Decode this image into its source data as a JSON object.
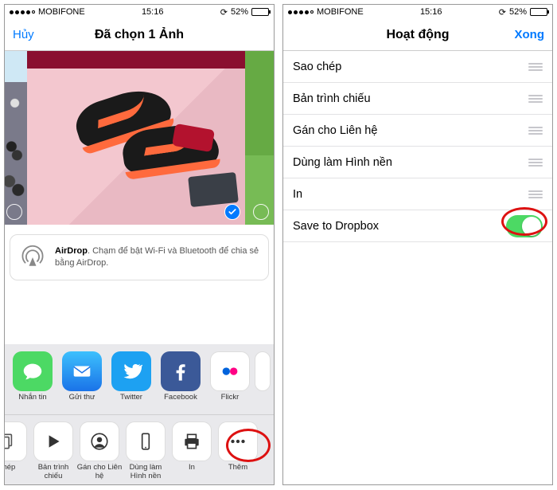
{
  "status": {
    "carrier": "MOBIFONE",
    "time": "15:16",
    "battery_pct": "52%"
  },
  "left": {
    "cancel": "Hủy",
    "title": "Đã chọn 1 Ảnh",
    "airdrop": {
      "title": "AirDrop",
      "text": ". Chạm để bật Wi-Fi và Bluetooth để chia sẻ bằng AirDrop."
    },
    "share": [
      {
        "name": "message",
        "label": "Nhắn tin",
        "color": "#4cd964"
      },
      {
        "name": "mail",
        "label": "Gửi thư",
        "color": "#1d9bf0"
      },
      {
        "name": "twitter",
        "label": "Twitter",
        "color": "#1da1f2"
      },
      {
        "name": "facebook",
        "label": "Facebook",
        "color": "#3b5998"
      },
      {
        "name": "flickr",
        "label": "Flickr",
        "color": "#ffffff"
      }
    ],
    "actions": [
      {
        "name": "copy",
        "label": "chép"
      },
      {
        "name": "slideshow",
        "label": "Bản trình chiếu"
      },
      {
        "name": "assign-contact",
        "label": "Gán cho Liên hệ"
      },
      {
        "name": "wallpaper",
        "label": "Dùng làm Hình nền"
      },
      {
        "name": "print",
        "label": "In"
      },
      {
        "name": "more",
        "label": "Thêm"
      }
    ]
  },
  "right": {
    "title": "Hoạt động",
    "done": "Xong",
    "rows": [
      {
        "label": "Sao chép",
        "control": "grip"
      },
      {
        "label": "Bản trình chiếu",
        "control": "grip"
      },
      {
        "label": "Gán cho Liên hệ",
        "control": "grip"
      },
      {
        "label": "Dùng làm Hình nền",
        "control": "grip"
      },
      {
        "label": "In",
        "control": "grip"
      },
      {
        "label": "Save to Dropbox",
        "control": "toggle-on"
      }
    ]
  }
}
